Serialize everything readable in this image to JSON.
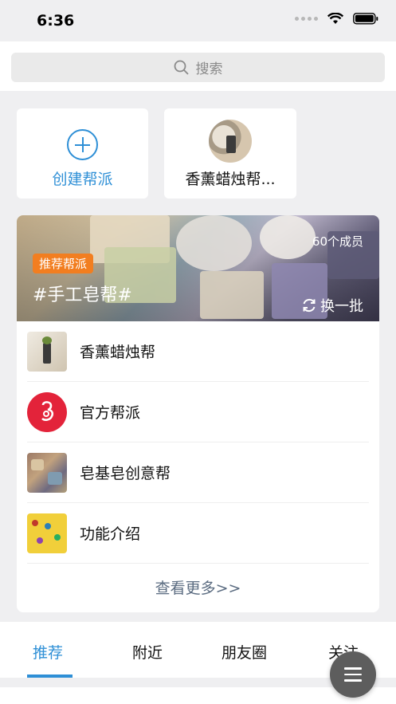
{
  "status_bar": {
    "time": "6:36"
  },
  "search": {
    "placeholder": "搜索"
  },
  "top_cards": {
    "create_label": "创建帮派",
    "joined_label": "香薰蜡烛帮..."
  },
  "banner": {
    "members": "60个成员",
    "tag": "推荐帮派",
    "title": "#手工皂帮#",
    "refresh_label": "换一批"
  },
  "groups": [
    {
      "label": "香薰蜡烛帮"
    },
    {
      "label": "官方帮派"
    },
    {
      "label": "皂基皂创意帮"
    },
    {
      "label": "功能介绍"
    }
  ],
  "see_more": "查看更多>>",
  "tabs": [
    {
      "label": "推荐",
      "active": true
    },
    {
      "label": "附近",
      "active": false
    },
    {
      "label": "朋友圈",
      "active": false
    },
    {
      "label": "关注",
      "active": false
    }
  ],
  "colors": {
    "accent": "#2e8fd6",
    "tag": "#f27e20",
    "official": "#e3233a"
  }
}
